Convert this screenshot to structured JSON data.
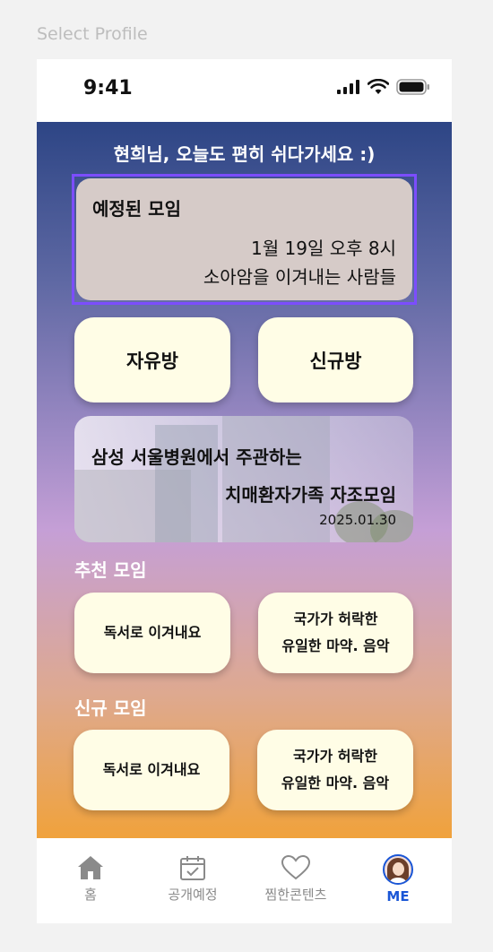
{
  "frame_label": "Select Profile",
  "status_bar": {
    "time": "9:41"
  },
  "greeting": "현희님, 오늘도 편히 쉬다가세요 :)",
  "upcoming": {
    "title": "예정된 모임",
    "date": "1월 19일 오후 8시",
    "name": "소아암을 이겨내는 사람들"
  },
  "rooms": {
    "free": "자유방",
    "new": "신규방"
  },
  "banner": {
    "line1": "삼성 서울병원에서 주관하는",
    "line2": "치매환자가족 자조모임",
    "date": "2025.01.30"
  },
  "recommended": {
    "title": "추천 모임",
    "items": [
      {
        "line1": "독서로 이겨내요",
        "line2": ""
      },
      {
        "line1": "국가가 허락한",
        "line2": "유일한 마약. 음악"
      }
    ]
  },
  "new_meetings": {
    "title": "신규 모임",
    "items": [
      {
        "line1": "독서로 이겨내요",
        "line2": ""
      },
      {
        "line1": "국가가 허락한",
        "line2": "유일한 마약. 음악"
      }
    ]
  },
  "tabs": [
    {
      "label": "홈",
      "icon": "home-icon"
    },
    {
      "label": "공개예정",
      "icon": "calendar-check-icon"
    },
    {
      "label": "찜한콘텐츠",
      "icon": "heart-icon"
    },
    {
      "label": "ME",
      "icon": "avatar"
    }
  ],
  "colors": {
    "accent": "#1a56d6",
    "selection": "#7c4dff",
    "card": "#fffde6"
  }
}
